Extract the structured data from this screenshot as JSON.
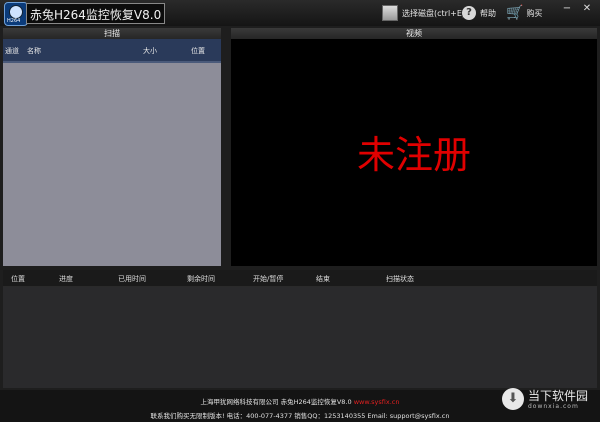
{
  "app": {
    "title": "赤兔H264监控恢复V8.0",
    "icon_tag": "H264"
  },
  "toolbar": {
    "select_disk": "选择磁盘(ctrl+E)",
    "help": "帮助",
    "buy": "购买",
    "minimize": "−",
    "close": "✕"
  },
  "scan_panel": {
    "title": "扫描",
    "columns": [
      "通道",
      "名称",
      "大小",
      "位置"
    ]
  },
  "video_panel": {
    "title": "视频",
    "overlay_text": "未注册",
    "overlay_color": "#e00000"
  },
  "status_table": {
    "columns": [
      "位置",
      "进度",
      "已用时间",
      "剩余时间",
      "开始/暂停",
      "结束",
      "扫描状态"
    ]
  },
  "footer": {
    "line1_company": "上海甲犹网络科技有限公司 赤兔H264监控恢复V8.0",
    "line1_url": "www.sysfix.cn",
    "line2": "联系我们购买无限制版本!  电话：400-077-4377  销售QQ：1253140355  Email: support@sysfix.cn"
  },
  "watermark": {
    "name": "当下软件园",
    "url": "downxia.com"
  },
  "colors": {
    "scan_bg": "#8d8d99",
    "video_bg": "#000000",
    "accent_red": "#e00000"
  }
}
